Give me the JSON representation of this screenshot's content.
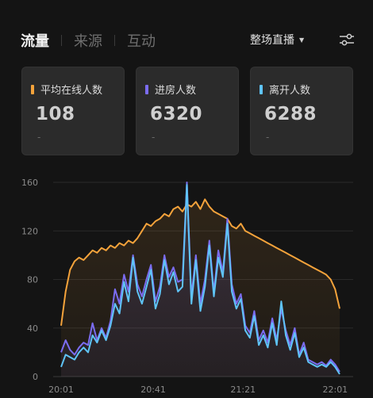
{
  "tabs": [
    {
      "label": "流量",
      "active": true
    },
    {
      "label": "来源",
      "active": false
    },
    {
      "label": "互动",
      "active": false
    }
  ],
  "scope_selector": {
    "label": "整场直播"
  },
  "filter_icon": "sliders-icon",
  "cards": [
    {
      "label": "平均在线人数",
      "value": "108",
      "delta": "-",
      "color": "#f5a33b"
    },
    {
      "label": "进房人数",
      "value": "6320",
      "delta": "-",
      "color": "#7b6cf0"
    },
    {
      "label": "离开人数",
      "value": "6288",
      "delta": "-",
      "color": "#5fc4f7"
    }
  ],
  "chart_data": {
    "type": "line",
    "ylim": [
      0,
      160
    ],
    "y_ticks": [
      "0",
      "40",
      "80",
      "120",
      "160"
    ],
    "x_ticks": [
      "20:01",
      "20:41",
      "21:21",
      "22:01"
    ],
    "grid": true,
    "series": [
      {
        "color": "#f5a33b",
        "points": [
          [
            0,
            42
          ],
          [
            1,
            70
          ],
          [
            2,
            88
          ],
          [
            3,
            95
          ],
          [
            4,
            98
          ],
          [
            5,
            96
          ],
          [
            6,
            100
          ],
          [
            7,
            104
          ],
          [
            8,
            102
          ],
          [
            9,
            106
          ],
          [
            10,
            104
          ],
          [
            11,
            108
          ],
          [
            12,
            106
          ],
          [
            13,
            110
          ],
          [
            14,
            108
          ],
          [
            15,
            112
          ],
          [
            16,
            110
          ],
          [
            17,
            114
          ],
          [
            18,
            120
          ],
          [
            19,
            126
          ],
          [
            20,
            124
          ],
          [
            21,
            128
          ],
          [
            22,
            130
          ],
          [
            23,
            134
          ],
          [
            24,
            132
          ],
          [
            25,
            138
          ],
          [
            26,
            140
          ],
          [
            27,
            136
          ],
          [
            28,
            142
          ],
          [
            29,
            140
          ],
          [
            30,
            144
          ],
          [
            31,
            138
          ],
          [
            32,
            146
          ],
          [
            33,
            140
          ],
          [
            34,
            136
          ],
          [
            35,
            134
          ],
          [
            36,
            132
          ],
          [
            37,
            130
          ],
          [
            38,
            124
          ],
          [
            39,
            122
          ],
          [
            40,
            126
          ],
          [
            41,
            120
          ],
          [
            42,
            118
          ],
          [
            43,
            116
          ],
          [
            44,
            114
          ],
          [
            45,
            112
          ],
          [
            46,
            110
          ],
          [
            47,
            108
          ],
          [
            48,
            106
          ],
          [
            49,
            104
          ],
          [
            50,
            102
          ],
          [
            51,
            100
          ],
          [
            52,
            98
          ],
          [
            53,
            96
          ],
          [
            54,
            94
          ],
          [
            55,
            92
          ],
          [
            56,
            90
          ],
          [
            57,
            88
          ],
          [
            58,
            86
          ],
          [
            59,
            84
          ],
          [
            60,
            80
          ],
          [
            61,
            72
          ],
          [
            62,
            56
          ]
        ]
      },
      {
        "color": "#7b6cf0",
        "points": [
          [
            0,
            20
          ],
          [
            1,
            30
          ],
          [
            2,
            22
          ],
          [
            3,
            18
          ],
          [
            4,
            24
          ],
          [
            5,
            28
          ],
          [
            6,
            26
          ],
          [
            7,
            44
          ],
          [
            8,
            30
          ],
          [
            9,
            40
          ],
          [
            10,
            32
          ],
          [
            11,
            46
          ],
          [
            12,
            72
          ],
          [
            13,
            60
          ],
          [
            14,
            84
          ],
          [
            15,
            70
          ],
          [
            16,
            100
          ],
          [
            17,
            76
          ],
          [
            18,
            66
          ],
          [
            19,
            80
          ],
          [
            20,
            92
          ],
          [
            21,
            62
          ],
          [
            22,
            74
          ],
          [
            23,
            100
          ],
          [
            24,
            82
          ],
          [
            25,
            90
          ],
          [
            26,
            78
          ],
          [
            27,
            80
          ],
          [
            28,
            160
          ],
          [
            29,
            66
          ],
          [
            30,
            100
          ],
          [
            31,
            60
          ],
          [
            32,
            80
          ],
          [
            33,
            112
          ],
          [
            34,
            70
          ],
          [
            35,
            104
          ],
          [
            36,
            86
          ],
          [
            37,
            130
          ],
          [
            38,
            76
          ],
          [
            39,
            60
          ],
          [
            40,
            68
          ],
          [
            41,
            42
          ],
          [
            42,
            36
          ],
          [
            43,
            54
          ],
          [
            44,
            30
          ],
          [
            45,
            38
          ],
          [
            46,
            28
          ],
          [
            47,
            48
          ],
          [
            48,
            30
          ],
          [
            49,
            56
          ],
          [
            50,
            38
          ],
          [
            51,
            26
          ],
          [
            52,
            40
          ],
          [
            53,
            18
          ],
          [
            54,
            28
          ],
          [
            55,
            14
          ],
          [
            56,
            12
          ],
          [
            57,
            10
          ],
          [
            58,
            12
          ],
          [
            59,
            9
          ],
          [
            60,
            14
          ],
          [
            61,
            10
          ],
          [
            62,
            4
          ]
        ]
      },
      {
        "color": "#5fc4f7",
        "points": [
          [
            0,
            8
          ],
          [
            1,
            18
          ],
          [
            2,
            16
          ],
          [
            3,
            14
          ],
          [
            4,
            20
          ],
          [
            5,
            24
          ],
          [
            6,
            20
          ],
          [
            7,
            34
          ],
          [
            8,
            28
          ],
          [
            9,
            38
          ],
          [
            10,
            30
          ],
          [
            11,
            42
          ],
          [
            12,
            60
          ],
          [
            13,
            52
          ],
          [
            14,
            78
          ],
          [
            15,
            62
          ],
          [
            16,
            98
          ],
          [
            17,
            70
          ],
          [
            18,
            60
          ],
          [
            19,
            74
          ],
          [
            20,
            88
          ],
          [
            21,
            56
          ],
          [
            22,
            68
          ],
          [
            23,
            96
          ],
          [
            24,
            76
          ],
          [
            25,
            86
          ],
          [
            26,
            70
          ],
          [
            27,
            74
          ],
          [
            28,
            158
          ],
          [
            29,
            60
          ],
          [
            30,
            96
          ],
          [
            31,
            54
          ],
          [
            32,
            74
          ],
          [
            33,
            108
          ],
          [
            34,
            66
          ],
          [
            35,
            98
          ],
          [
            36,
            82
          ],
          [
            37,
            126
          ],
          [
            38,
            70
          ],
          [
            39,
            56
          ],
          [
            40,
            64
          ],
          [
            41,
            38
          ],
          [
            42,
            32
          ],
          [
            43,
            50
          ],
          [
            44,
            26
          ],
          [
            45,
            34
          ],
          [
            46,
            24
          ],
          [
            47,
            44
          ],
          [
            48,
            26
          ],
          [
            49,
            62
          ],
          [
            50,
            34
          ],
          [
            51,
            22
          ],
          [
            52,
            36
          ],
          [
            53,
            16
          ],
          [
            54,
            24
          ],
          [
            55,
            12
          ],
          [
            56,
            10
          ],
          [
            57,
            8
          ],
          [
            58,
            10
          ],
          [
            59,
            8
          ],
          [
            60,
            12
          ],
          [
            61,
            8
          ],
          [
            62,
            2
          ]
        ]
      }
    ]
  }
}
